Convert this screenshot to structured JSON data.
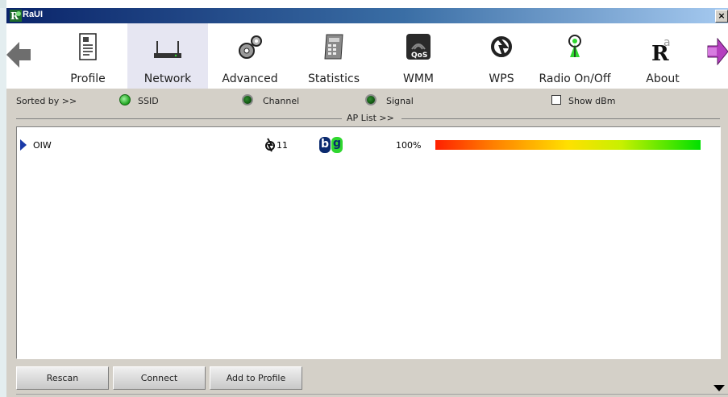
{
  "window": {
    "title": "RaUI",
    "close_glyph": "×"
  },
  "toolbar": {
    "items": [
      {
        "label": "Profile",
        "icon": "profile-icon"
      },
      {
        "label": "Network",
        "icon": "network-icon",
        "selected": true
      },
      {
        "label": "Advanced",
        "icon": "advanced-gears-icon"
      },
      {
        "label": "Statistics",
        "icon": "statistics-icon"
      },
      {
        "label": "WMM",
        "icon": "qos-icon",
        "icon_text": "QoS"
      },
      {
        "label": "WPS",
        "icon": "wps-icon"
      },
      {
        "label": "Radio On/Off",
        "icon": "radio-icon"
      },
      {
        "label": "About",
        "icon": "about-icon",
        "icon_text": "R"
      }
    ],
    "prev_icon": "arrow-left-icon",
    "next_icon": "arrow-right-icon"
  },
  "sort": {
    "label": "Sorted by >>",
    "options": [
      {
        "label": "SSID",
        "selected": true
      },
      {
        "label": "Channel",
        "selected": false
      },
      {
        "label": "Signal",
        "selected": false
      }
    ],
    "show_dbm_label": "Show dBm",
    "show_dbm_checked": false
  },
  "ap_list": {
    "title": "AP List >>",
    "rows": [
      {
        "ssid": "OIW",
        "channel": "11",
        "mode_b": "b",
        "mode_g": "g",
        "signal": "100%",
        "signal_fraction": 1.0
      }
    ]
  },
  "buttons": {
    "rescan": "Rescan",
    "connect": "Connect",
    "add_to_profile": "Add to Profile"
  },
  "colors": {
    "titlebar_start": "#0a246a",
    "selected_tab": "#e6e6f2",
    "mode_b_bg": "#0b2a6e",
    "mode_g_bg": "#2fd72f"
  }
}
